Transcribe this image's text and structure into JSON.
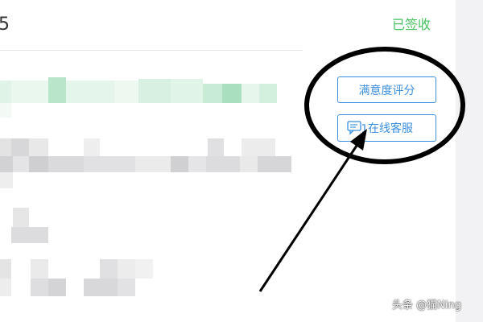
{
  "header": {
    "order_number_fragment": "5",
    "status": "已签收"
  },
  "actions": {
    "rating_label": "满意度评分",
    "service_label": "在线客服"
  },
  "watermark": {
    "text": "头条 @猫Ning"
  },
  "icons": {
    "service": "chat-bubble-icon"
  },
  "colors": {
    "status_green": "#46c35f",
    "button_blue": "#3b8fe0",
    "annotation": "#000000"
  }
}
